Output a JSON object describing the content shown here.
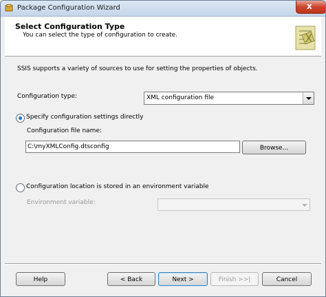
{
  "window": {
    "title": "Package Configuration Wizard",
    "close_glyph": "x"
  },
  "header": {
    "title": "Select Configuration Type",
    "subtitle": "You can select the type of configuration to create.",
    "icon": "wizard-graphic-icon"
  },
  "description": "SSIS supports a variety of sources to use for setting the properties of objects.",
  "config_type": {
    "label": "Configuration type:",
    "selected": "XML configuration file"
  },
  "option_direct": {
    "label": "Specify configuration settings directly",
    "checked": true,
    "file_label": "Configuration file name:",
    "file_value": "C:\\myXMLConfig.dtsconfig",
    "browse_label": "Browse..."
  },
  "option_env": {
    "label": "Configuration location is stored in an environment variable",
    "checked": false,
    "var_label": "Environment variable:",
    "var_value": ""
  },
  "footer": {
    "help": "Help",
    "back": "< Back",
    "next": "Next >",
    "finish": "Finish >>|",
    "cancel": "Cancel"
  }
}
